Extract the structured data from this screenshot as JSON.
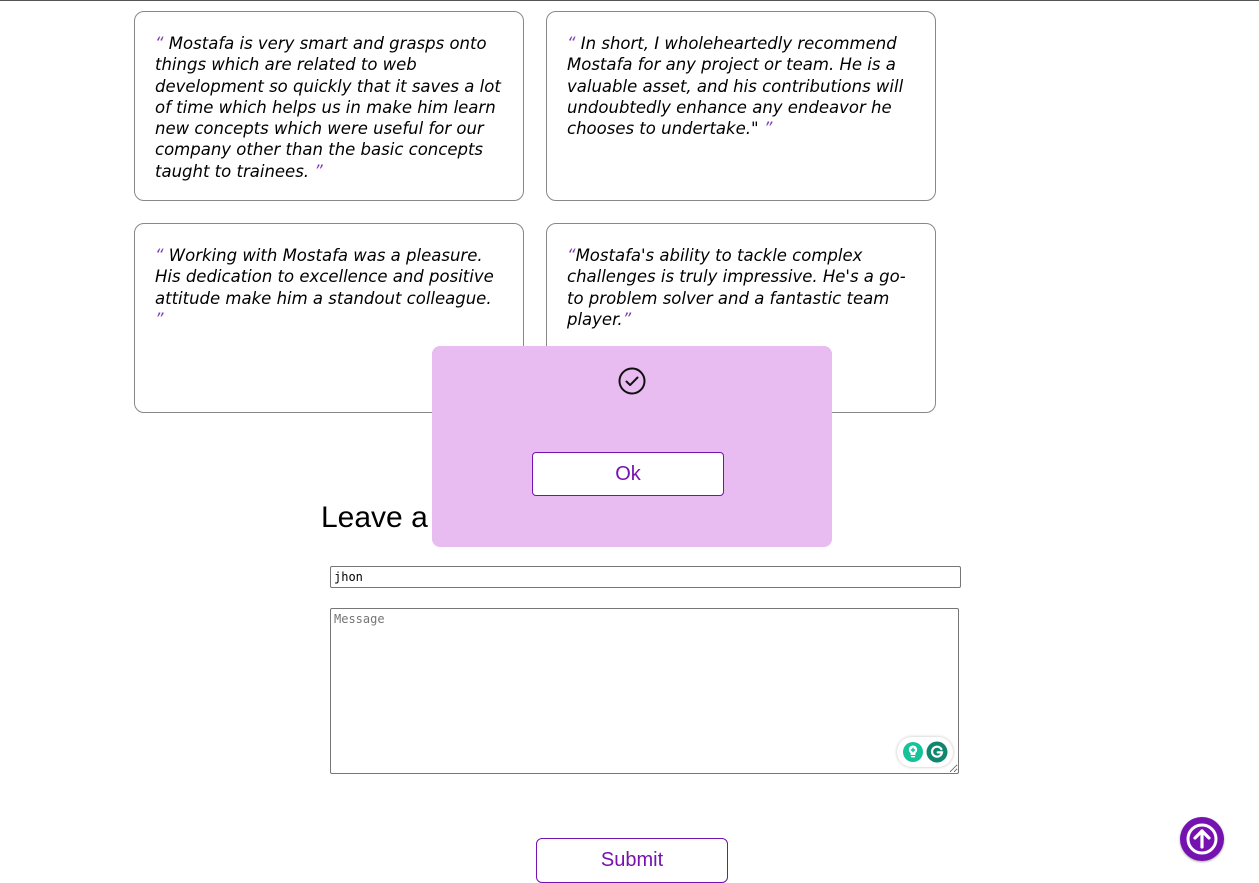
{
  "testimonials": [
    {
      "open": "“",
      "text": " Mostafa is very smart and grasps onto things which are related to web development so quickly that it saves a lot of time which helps us in make him learn new concepts which were useful for our company other than the basic concepts taught to trainees. ",
      "close": "”"
    },
    {
      "open": "“",
      "text": " In short, I wholeheartedly recommend Mostafa for any project or team. He is a valuable asset, and his contributions will undoubtedly enhance any endeavor he chooses to undertake.\" ",
      "close": "”"
    },
    {
      "open": "“",
      "text": " Working with Mostafa was a pleasure. His dedication to excellence and positive attitude make him a standout colleague. ",
      "close": "”"
    },
    {
      "open": "“",
      "text": "Mostafa's ability to tackle complex challenges is truly impressive. He's a go-to problem solver and a fantastic team player.",
      "close": "”"
    }
  ],
  "form": {
    "heading": "Leave a",
    "name_value": "jhon",
    "message_placeholder": "Message",
    "submit_label": "Submit"
  },
  "modal": {
    "icon": "check-circle-icon",
    "ok_label": "Ok"
  },
  "widgets": {
    "grammarly_icons": [
      "lightbulb-icon",
      "grammarly-logo-icon"
    ],
    "scroll_top_icon": "arrow-up-icon"
  },
  "colors": {
    "accent": "#7512b0",
    "modal_bg": "#e8bcf0",
    "quote_mark": "#7e3fb3",
    "grammarly": "#15c39a"
  }
}
